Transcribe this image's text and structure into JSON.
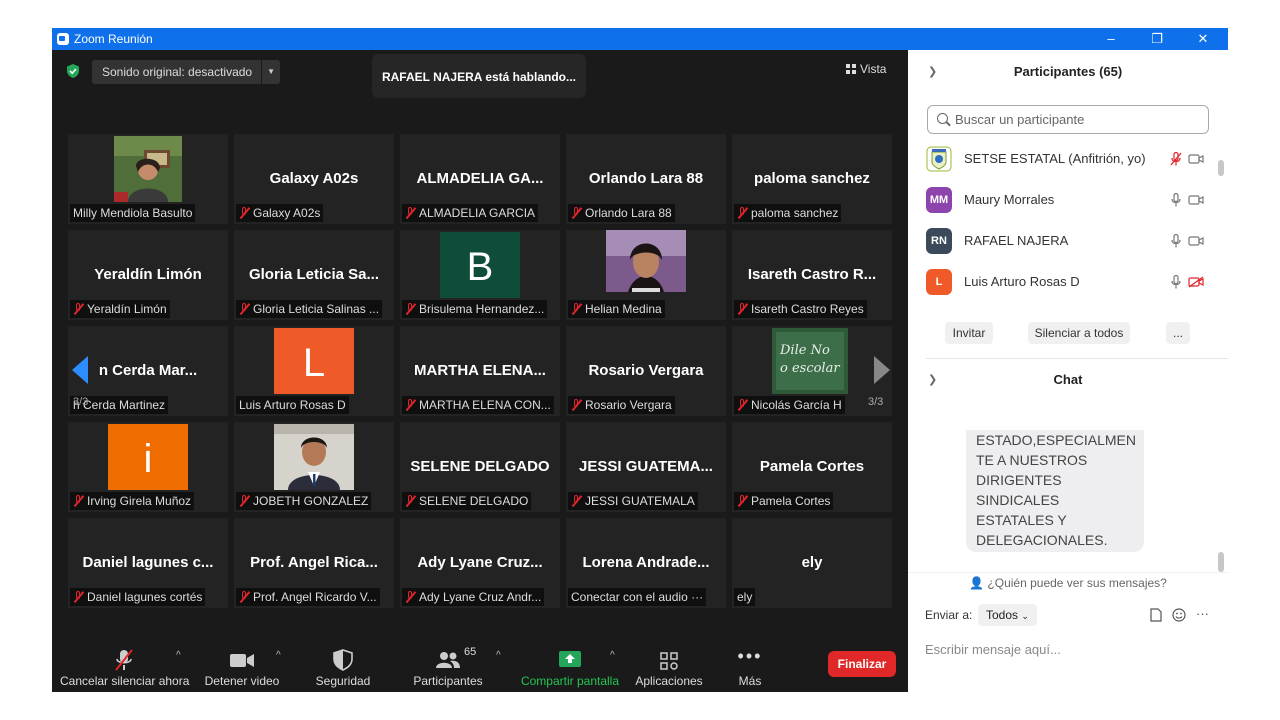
{
  "window": {
    "title": "Zoom Reunión",
    "minimize": "–",
    "restore": "❐",
    "close": "✕"
  },
  "top": {
    "audio": "Sonido original: desactivado",
    "speaking": "RAFAEL NAJERA está hablando...",
    "view": "Vista"
  },
  "page_indicator": "3/3",
  "tiles": [
    {
      "big": "",
      "label": "Milly Mendiola Basulto",
      "muted": false,
      "photo": "person"
    },
    {
      "big": "Galaxy A02s",
      "label": "Galaxy A02s",
      "muted": true
    },
    {
      "big": "ALMADELIA GA...",
      "label": "ALMADELIA GARCIA",
      "muted": true
    },
    {
      "big": "Orlando Lara 88",
      "label": "Orlando Lara 88",
      "muted": true
    },
    {
      "big": "paloma sanchez",
      "label": "paloma sanchez",
      "muted": true
    },
    {
      "big": "Yeraldín Limón",
      "label": "Yeraldín Limón",
      "muted": true
    },
    {
      "big": "Gloria Leticia Sa...",
      "label": "Gloria Leticia Salinas ...",
      "muted": true
    },
    {
      "big": "",
      "label": "Brisulema Hernandez...",
      "muted": true,
      "avatar": "B",
      "avatar_color": "#0f4d3a"
    },
    {
      "big": "",
      "label": "Helian Medina",
      "muted": true,
      "photo": "woman"
    },
    {
      "big": "Isareth Castro R...",
      "label": "Isareth Castro Reyes",
      "muted": true
    },
    {
      "big": "n Cerda Mar...",
      "label": "h Cerda Martinez",
      "muted": false
    },
    {
      "big": "",
      "label": "Luis Arturo Rosas D",
      "muted": false,
      "avatar": "L",
      "avatar_color": "#f05a28"
    },
    {
      "big": "MARTHA ELENA...",
      "label": "MARTHA ELENA CON...",
      "muted": true
    },
    {
      "big": "Rosario Vergara",
      "label": "Rosario Vergara",
      "muted": true
    },
    {
      "big": "",
      "label": "Nicolás García H",
      "muted": true,
      "photo": "chalkboard"
    },
    {
      "big": "",
      "label": "Irving Girela Muñoz",
      "muted": true,
      "avatar": "i",
      "avatar_color": "#ef6c00"
    },
    {
      "big": "",
      "label": "JOBETH GONZALEZ",
      "muted": true,
      "photo": "man"
    },
    {
      "big": "SELENE DELGADO",
      "label": "SELENE DELGADO",
      "muted": true
    },
    {
      "big": "JESSI GUATEMA...",
      "label": "JESSI GUATEMALA",
      "muted": true
    },
    {
      "big": "Pamela Cortes",
      "label": "Pamela Cortes",
      "muted": true
    },
    {
      "big": "Daniel lagunes c...",
      "label": "Daniel lagunes cortés",
      "muted": true
    },
    {
      "big": "Prof. Angel Rica...",
      "label": "Prof. Angel Ricardo V...",
      "muted": true
    },
    {
      "big": "Ady Lyane Cruz...",
      "label": "Ady Lyane Cruz Andr...",
      "muted": true
    },
    {
      "big": "Lorena Andrade...",
      "label": "Conectar con el audio ···",
      "muted": false
    },
    {
      "big": "ely",
      "label": "ely",
      "muted": false
    }
  ],
  "toolbar": {
    "unmute": "Cancelar silenciar ahora",
    "video": "Detener video",
    "security": "Seguridad",
    "participants": "Participantes",
    "participants_count": "65",
    "share": "Compartir pantalla",
    "apps": "Aplicaciones",
    "more": "Más",
    "end": "Finalizar"
  },
  "participants_panel": {
    "title": "Participantes (65)",
    "search_placeholder": "Buscar un participante",
    "list": [
      {
        "initials": "",
        "name": "SETSE ESTATAL (Anfitrión, yo)",
        "color": "#ffffff",
        "mic_muted": true,
        "cam_off": false
      },
      {
        "initials": "MM",
        "name": "Maury Morrales",
        "color": "#8e44ad",
        "mic_muted": false,
        "cam_off": false
      },
      {
        "initials": "RN",
        "name": "RAFAEL NAJERA",
        "color": "#3b4a5a",
        "mic_muted": false,
        "cam_off": false
      },
      {
        "initials": "L",
        "name": "Luis Arturo Rosas D",
        "color": "#f05a28",
        "mic_muted": false,
        "cam_off": true
      }
    ],
    "invite": "Invitar",
    "mute_all": "Silenciar a todos",
    "more": "..."
  },
  "chat": {
    "title": "Chat",
    "message_lines": [
      "ESTADO,ESPECIALMEN",
      "TE A NUESTROS",
      "DIRIGENTES",
      "SINDICALES",
      "ESTATALES Y",
      "DELEGACIONALES."
    ],
    "who_can_see": "¿Quién puede ver sus mensajes?",
    "send_to_label": "Enviar a:",
    "send_to_value": "Todos",
    "input_placeholder": "Escribir mensaje aquí..."
  }
}
